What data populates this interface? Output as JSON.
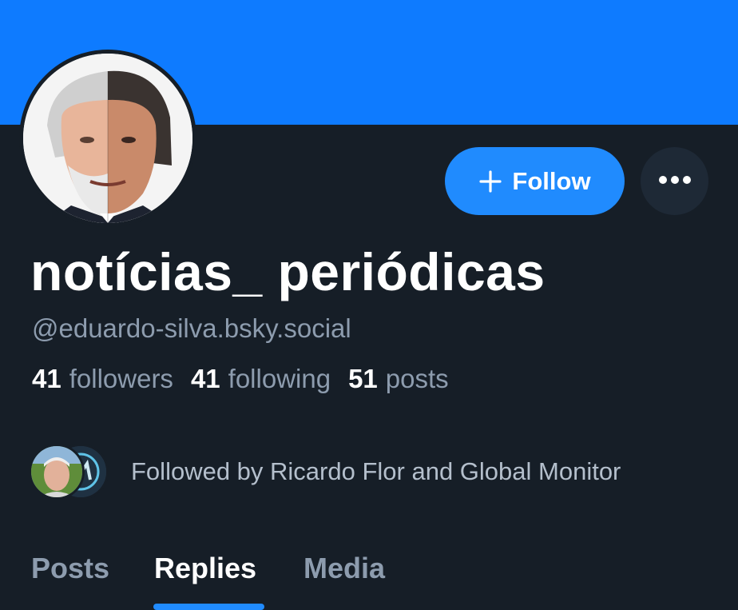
{
  "header": {
    "banner_color": "#0e7bff"
  },
  "profile": {
    "avatar_icon": "profile-avatar-image",
    "display_name": "notícias_ periódicas",
    "handle": "@eduardo-silva.bsky.social"
  },
  "actions": {
    "follow_label": "Follow",
    "follow_icon": "plus-icon",
    "more_icon": "ellipsis-icon",
    "accent_color": "#208bfe"
  },
  "stats": [
    {
      "count": "41",
      "label": "followers"
    },
    {
      "count": "41",
      "label": "following"
    },
    {
      "count": "51",
      "label": "posts"
    }
  ],
  "followed_by": {
    "text": "Followed by Ricardo Flor and Global Monitor"
  },
  "tabs": [
    {
      "label": "Posts",
      "active": false
    },
    {
      "label": "Replies",
      "active": true
    },
    {
      "label": "Media",
      "active": false
    }
  ]
}
